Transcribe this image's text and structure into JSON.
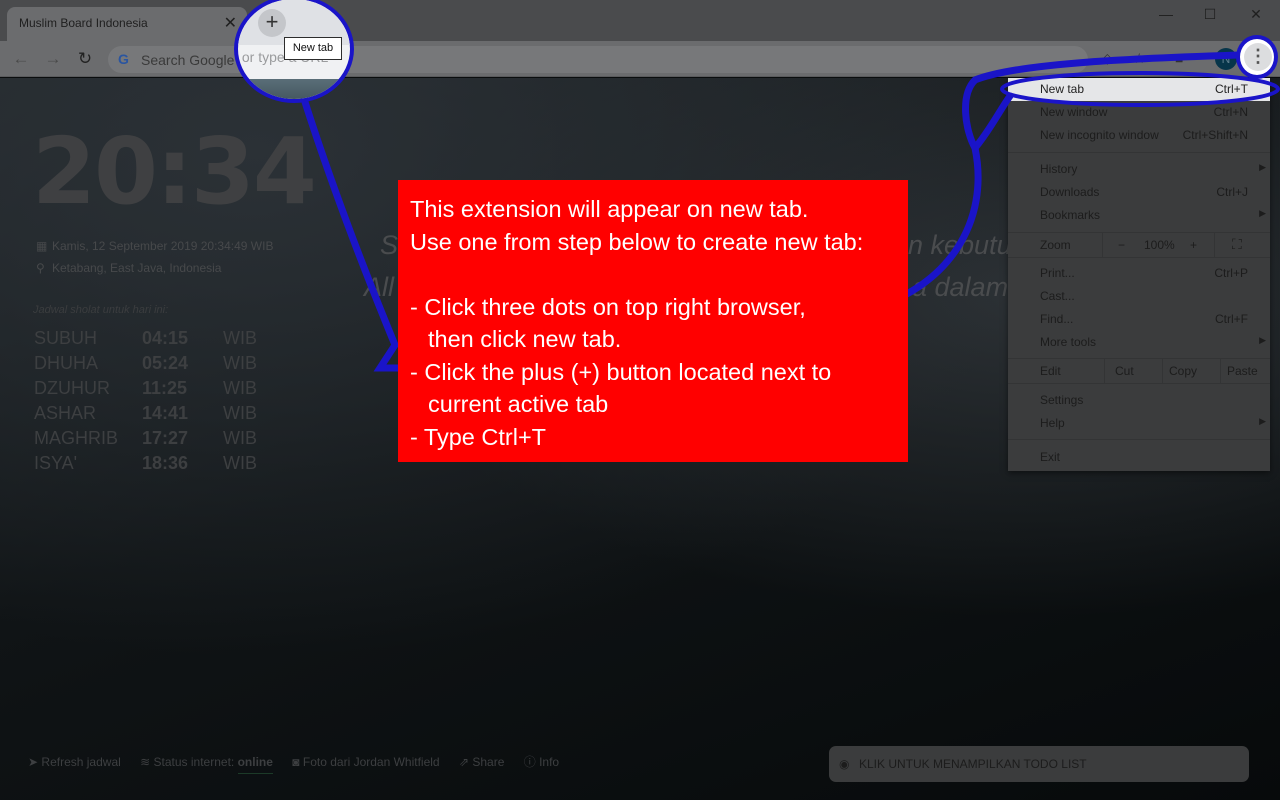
{
  "browser": {
    "tab_title": "Muslim Board Indonesia",
    "tab_close": "✕",
    "new_tab_tooltip": "New tab",
    "new_tab_plus": "+",
    "window_controls": {
      "minimize": "—",
      "maximize": "☐",
      "close": "✕"
    },
    "nav": {
      "back": "←",
      "forward": "→",
      "reload": "↻"
    },
    "omnibox_placeholder": "Search Google or type a URL",
    "omnibox_logo": "G",
    "toolbar_icons": {
      "extension": "◇",
      "star": "☆",
      "ext2": "■"
    },
    "avatar_initial": "N",
    "menu_dots": "⋮"
  },
  "menu": {
    "items_top": [
      {
        "label": "New tab",
        "shortcut": "Ctrl+T"
      },
      {
        "label": "New window",
        "shortcut": "Ctrl+N"
      },
      {
        "label": "New incognito window",
        "shortcut": "Ctrl+Shift+N"
      }
    ],
    "items_mid": [
      {
        "label": "History",
        "shortcut": "",
        "submenu": "▶"
      },
      {
        "label": "Downloads",
        "shortcut": "Ctrl+J"
      },
      {
        "label": "Bookmarks",
        "shortcut": "",
        "submenu": "▶"
      }
    ],
    "zoom": {
      "label": "Zoom",
      "minus": "−",
      "value": "100%",
      "plus": "+",
      "fullscreen": "⛶"
    },
    "items_tools": [
      {
        "label": "Print...",
        "shortcut": "Ctrl+P"
      },
      {
        "label": "Cast...",
        "shortcut": ""
      },
      {
        "label": "Find...",
        "shortcut": "Ctrl+F"
      },
      {
        "label": "More tools",
        "shortcut": "",
        "submenu": "▶"
      }
    ],
    "edit": {
      "label": "Edit",
      "cut": "Cut",
      "copy": "Copy",
      "paste": "Paste"
    },
    "items_bottom": [
      {
        "label": "Settings"
      },
      {
        "label": "Help",
        "submenu": "▶"
      }
    ],
    "exit": "Exit"
  },
  "page": {
    "clock": "20:34",
    "date": "Kamis, 12 September 2019 20:34:49 WIB",
    "location": "Ketabang, East Java, Indonesia",
    "calendar_icon": "▦",
    "pin_icon": "⚲",
    "schedule_label": "Jadwal sholat untuk hari ini:",
    "prayers": [
      {
        "name": "SUBUH",
        "time": "04:15",
        "zone": "WIB"
      },
      {
        "name": "DHUHA",
        "time": "05:24",
        "zone": "WIB"
      },
      {
        "name": "DZUHUR",
        "time": "11:25",
        "zone": "WIB"
      },
      {
        "name": "ASHAR",
        "time": "14:41",
        "zone": "WIB"
      },
      {
        "name": "MAGHRIB",
        "time": "17:27",
        "zone": "WIB"
      },
      {
        "name": "ISYA'",
        "time": "18:36",
        "zone": "WIB"
      }
    ],
    "quote_line1_left": "S",
    "quote_line1_right": "n kebutu",
    "quote_line2_left": "All",
    "quote_line2_right": "a dalam",
    "footer": {
      "refresh": "Refresh jadwal",
      "status_label": "Status internet:",
      "status_value": "online",
      "photo": "Foto dari Jordan Whitfield",
      "share": "Share",
      "info": "Info",
      "icons": {
        "refresh": "➤",
        "wifi": "≋",
        "camera": "◙",
        "share": "⇗",
        "info": "ⓘ"
      }
    },
    "todo_button": "KLIK UNTUK MENAMPILKAN TODO LIST",
    "todo_icon": "◉"
  },
  "annotation": {
    "lines": [
      "This extension will appear on new tab.",
      "Use one from step below to create new tab:",
      "",
      "- Click three dots on top right browser,",
      "then click new tab.",
      "- Click the plus (+) button located next to",
      "current active tab",
      "- Type Ctrl+T"
    ],
    "box_color": "#ff0000",
    "marker_color": "#1a14c8"
  }
}
